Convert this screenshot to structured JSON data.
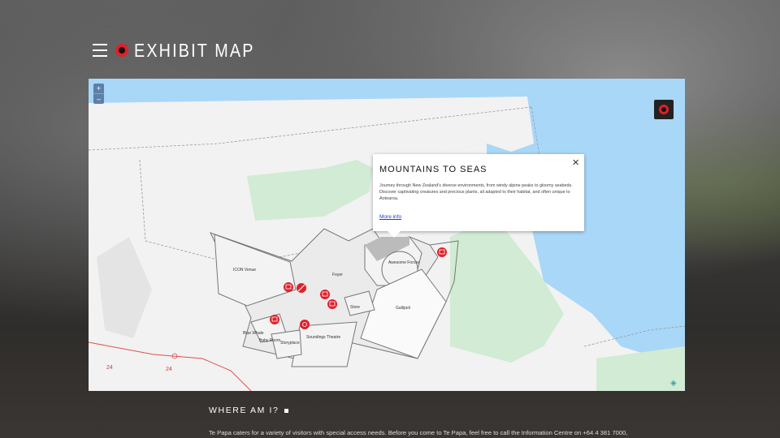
{
  "header": {
    "title": "EXHIBIT MAP"
  },
  "map": {
    "zoom_in_label": "+",
    "zoom_out_label": "–",
    "colors": {
      "water": "#a9d7f7",
      "park": "#d2ebd4",
      "building": "#ebebeb",
      "outline": "#777777",
      "marker": "#e0202a",
      "road": "#e05050"
    },
    "room_labels": {
      "icon_venue": "ICON Venue",
      "foyer": "Foyer",
      "awesome_forces": "Awesome Forces",
      "store": "Store",
      "gallipoli": "Gallipoli",
      "blue_whale": "Blue Whale",
      "baby_room": "Baby Room",
      "storyplace": "Storyplace",
      "soundings_theatre": "Soundings Theatre"
    },
    "road_labels": {
      "left": "24",
      "right": "24"
    },
    "markers": [
      "parent-room-icon",
      "cafe-icon",
      "toilets-icon",
      "toilets-icon",
      "accessible-icon",
      "toilets-icon",
      "toilets-icon"
    ]
  },
  "popup": {
    "title": "MOUNTAINS TO SEAS",
    "description": "Journey through New Zealand's diverse environments, from windy alpine peaks to gloomy seabeds. Discover captivating creatures and precious plants, all adapted to their habitat, and often unique to Aotearoa.",
    "link_label": "More info",
    "close_label": "×"
  },
  "where": {
    "heading": "WHERE AM I?",
    "text": "Te Papa caters for a variety of visitors with special access needs. Before you come to Te Papa, feel free to call the Information Centre on +64 4 381 7000,"
  }
}
